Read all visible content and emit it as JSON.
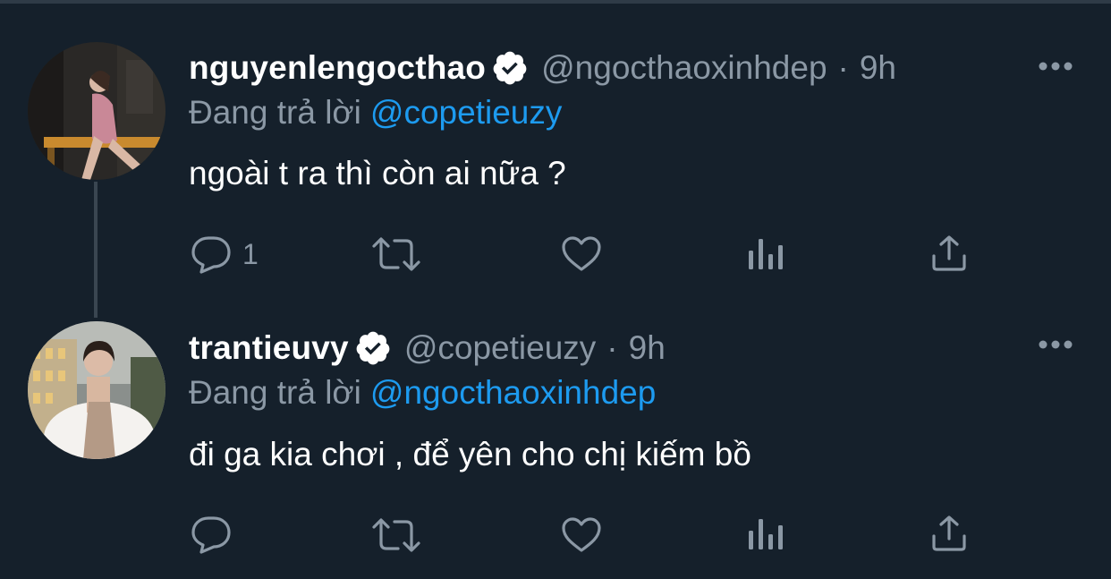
{
  "colors": {
    "background": "#15202b",
    "text": "#ffffff",
    "muted": "#8b98a5",
    "accent": "#1d9bf0",
    "verified_badge": "#ffffff"
  },
  "tweets": [
    {
      "display_name": "nguyenlengocthao",
      "verified": true,
      "handle": "@ngocthaoxinhdep",
      "separator": "·",
      "time": "9h",
      "reply_prefix": "Đang trả lời",
      "reply_to": "@copetieuzy",
      "text": "ngoài t ra thì còn ai nữa ?",
      "actions": {
        "reply_icon": "reply-icon",
        "reply_count": "1",
        "retweet_icon": "retweet-icon",
        "like_icon": "heart-icon",
        "analytics_icon": "analytics-icon",
        "share_icon": "share-icon"
      }
    },
    {
      "display_name": "trantieuvy",
      "verified": true,
      "handle": "@copetieuzy",
      "separator": "·",
      "time": "9h",
      "reply_prefix": "Đang trả lời",
      "reply_to": "@ngocthaoxinhdep",
      "text": "đi ga kia chơi , để yên cho chị kiếm bồ",
      "actions": {
        "reply_icon": "reply-icon",
        "reply_count": "",
        "retweet_icon": "retweet-icon",
        "like_icon": "heart-icon",
        "analytics_icon": "analytics-icon",
        "share_icon": "share-icon"
      }
    }
  ]
}
